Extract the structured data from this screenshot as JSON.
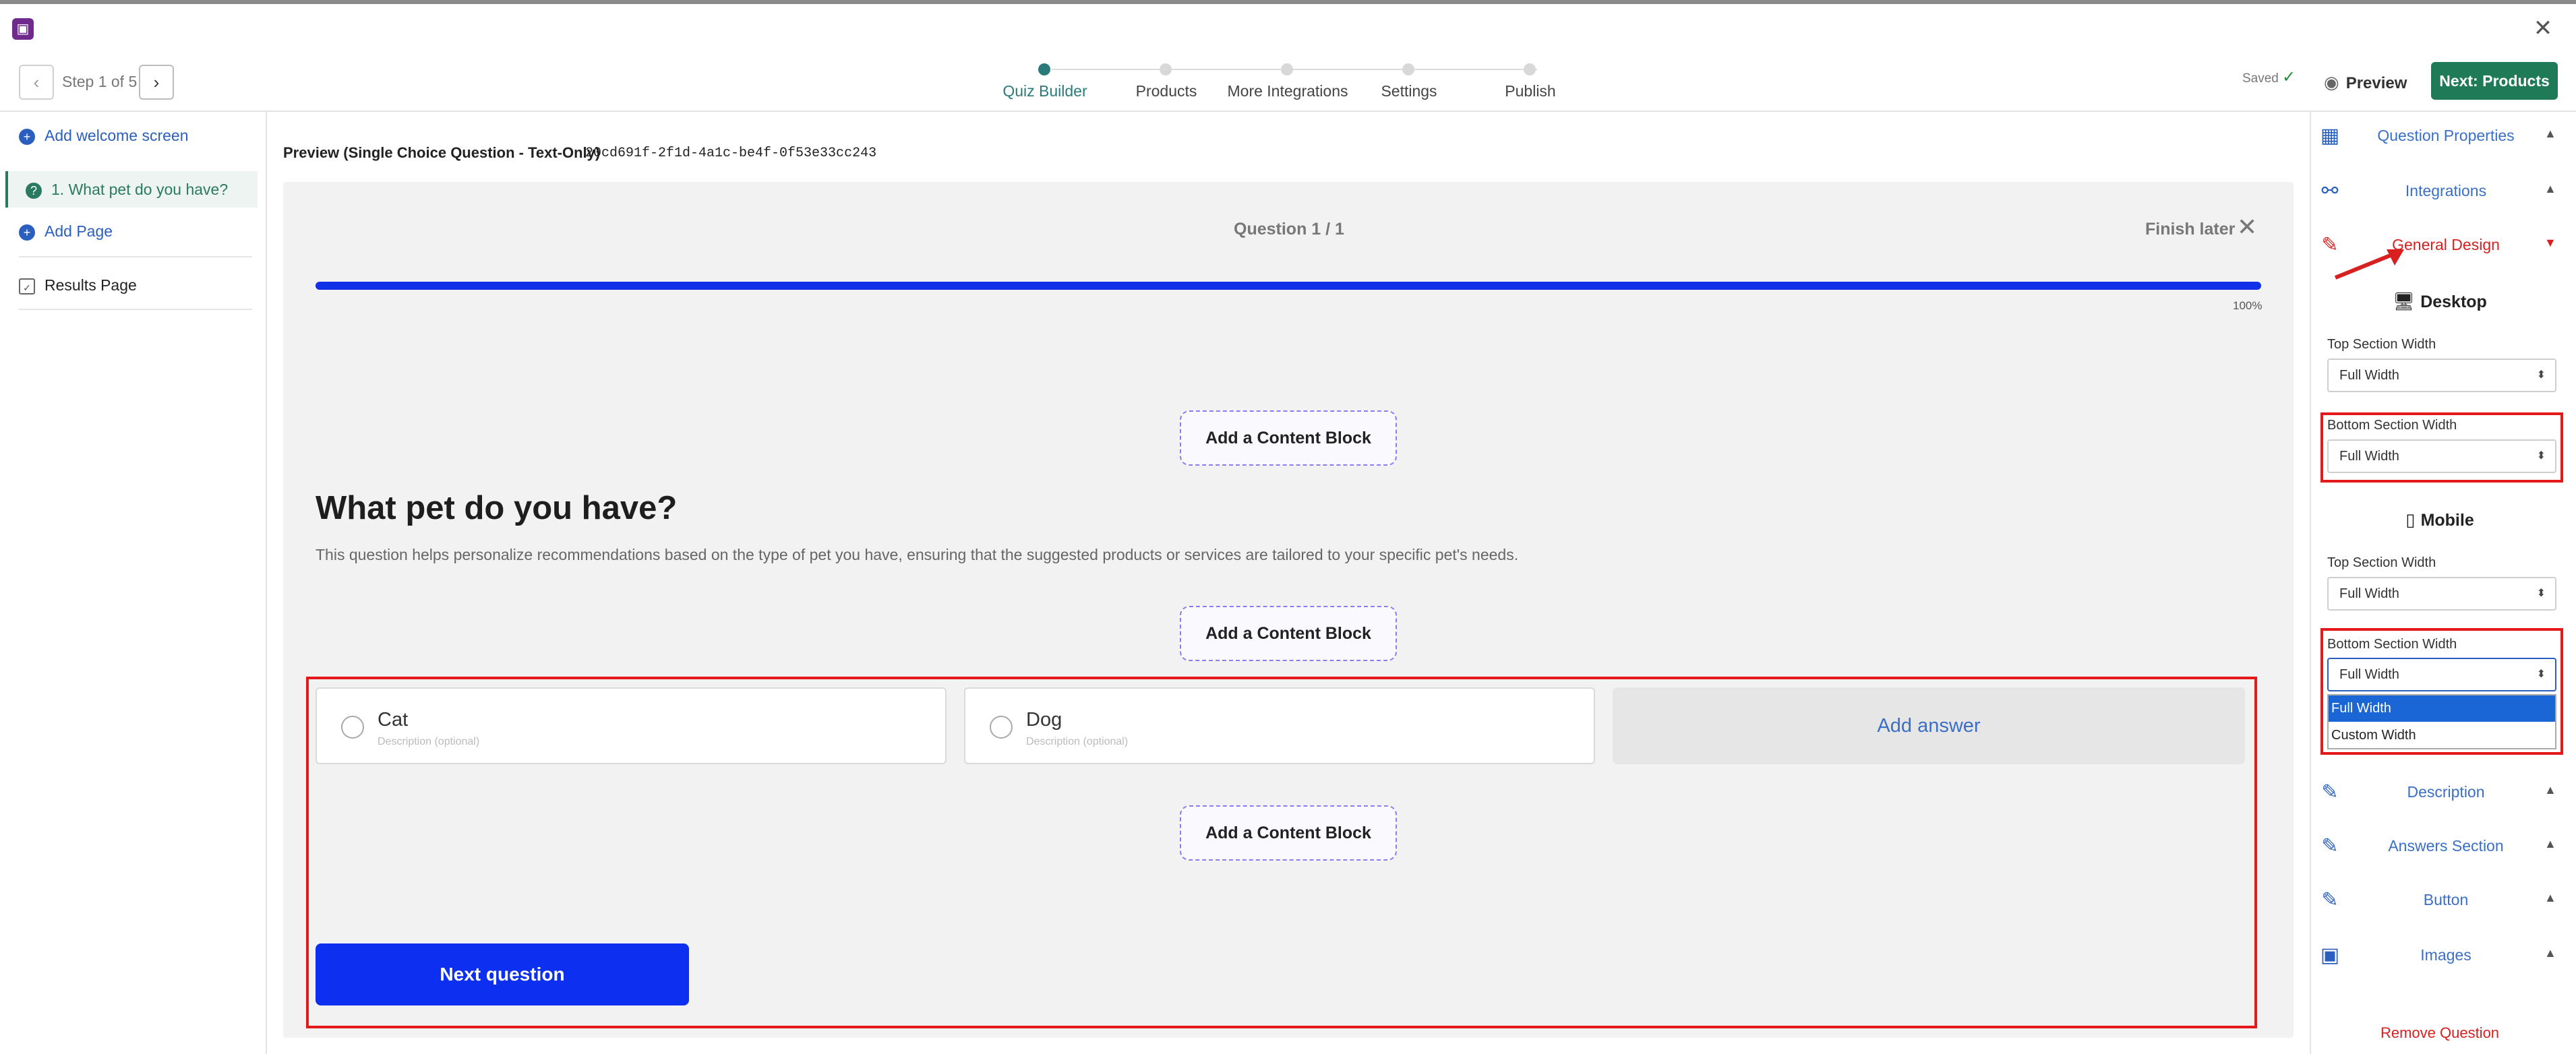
{
  "window": {
    "close_icon": "✕"
  },
  "toolbar": {
    "step_label": "Step 1 of 5",
    "steps": [
      {
        "label": "Quiz Builder",
        "active": true
      },
      {
        "label": "Products",
        "active": false
      },
      {
        "label": "More Integrations",
        "active": false
      },
      {
        "label": "Settings",
        "active": false
      },
      {
        "label": "Publish",
        "active": false
      }
    ],
    "saved_label": "Saved",
    "preview_label": "Preview",
    "next_label": "Next: Products"
  },
  "sidebar": {
    "items": [
      {
        "label": "Add welcome screen"
      },
      {
        "label": "1. What pet do you have?"
      },
      {
        "label": "Add Page"
      },
      {
        "label": "Results Page"
      }
    ]
  },
  "preview": {
    "title": "Preview (Single Choice Question - Text-Only)",
    "id": "20cd691f-2f1d-4a1c-be4f-0f53e33cc243",
    "question_counter": "Question 1 / 1",
    "finish_later": "Finish later",
    "progress_percent": 100,
    "progress_label": "100%",
    "content_block_label": "Add a Content Block",
    "question_title": "What pet do you have?",
    "question_description": "This question helps personalize recommendations based on the type of pet you have, ensuring that the suggested products or services are tailored to your specific pet's needs.",
    "answers": [
      {
        "label": "Cat",
        "description_placeholder": "Description (optional)"
      },
      {
        "label": "Dog",
        "description_placeholder": "Description (optional)"
      }
    ],
    "add_answer": "Add answer",
    "next_question": "Next question"
  },
  "right_panel": {
    "sections_top": [
      {
        "label": "Question Properties",
        "icon": "layout-icon"
      },
      {
        "label": "Integrations",
        "icon": "network-icon"
      },
      {
        "label": "General Design",
        "icon": "brush-icon"
      }
    ],
    "desktop_heading": "Desktop",
    "mobile_heading": "Mobile",
    "top_section_width_label": "Top Section Width",
    "bottom_section_width_label": "Bottom Section Width",
    "desktop_top_value": "Full Width",
    "desktop_bottom_value": "Full Width",
    "mobile_top_value": "Full Width",
    "mobile_bottom_value": "Full Width",
    "dropdown_options": [
      "Full Width",
      "Custom Width"
    ],
    "sections_bottom": [
      {
        "label": "Description"
      },
      {
        "label": "Answers Section"
      },
      {
        "label": "Button"
      },
      {
        "label": "Images"
      }
    ],
    "remove_question": "Remove Question"
  },
  "colors": {
    "accent_green": "#1f7a57",
    "active_step": "#2a7a7a",
    "link_blue": "#3a6fc8",
    "progress_blue": "#1230e8",
    "cta_blue": "#0c2ff0",
    "highlight_red": "#e41a1a"
  }
}
